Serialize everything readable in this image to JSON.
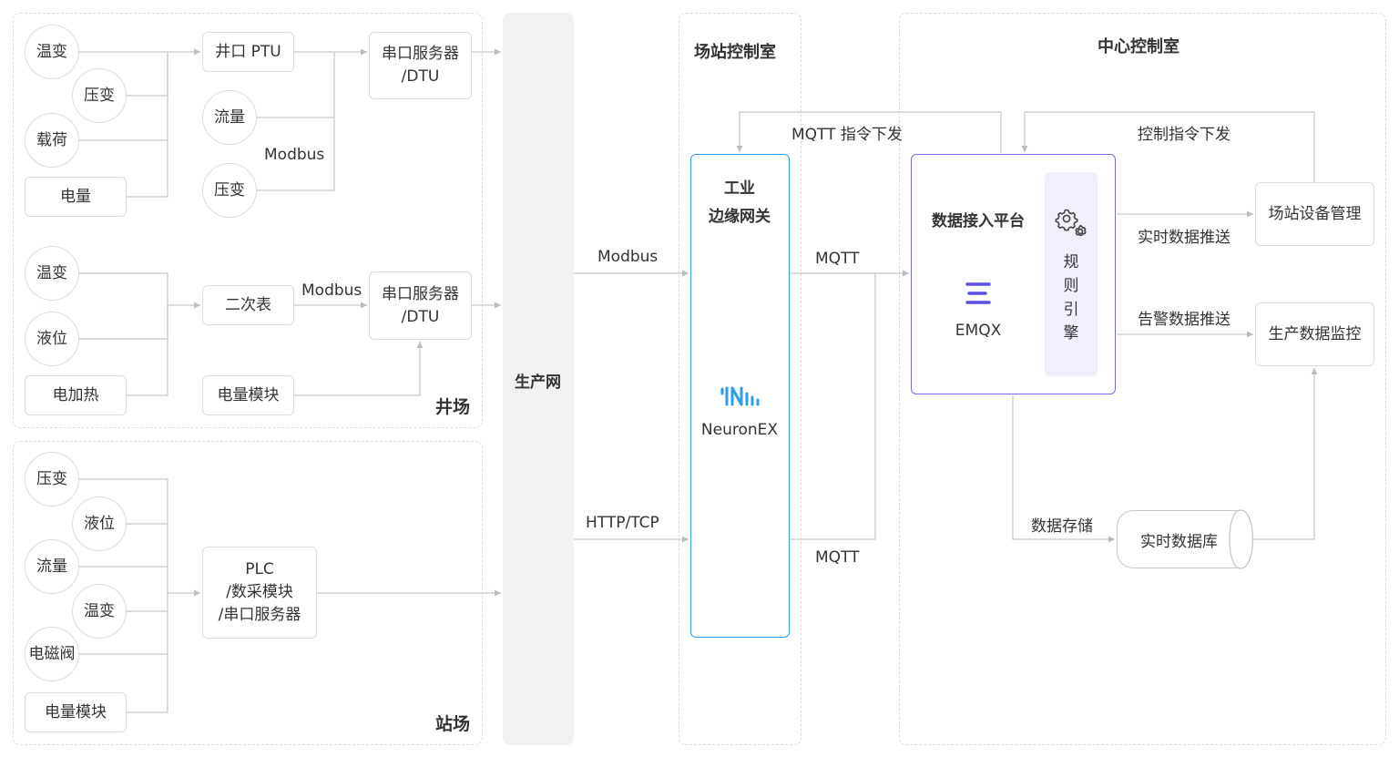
{
  "colors": {
    "line": "#c8c8c8",
    "node_border": "#dddddd",
    "gateway": "#2e9ee8",
    "platform": "#7a68e0",
    "rule_bg": "#f1effc",
    "emqx": "#5b4fe0",
    "neuron": "#2e9ee8",
    "band": "#f2f2f2"
  },
  "icons": [
    "emqx-logo-icon",
    "neuronex-logo-icon",
    "gear-icon"
  ],
  "well": {
    "title": "井场",
    "r1": {
      "wentemp": "温变",
      "yabian": "压变",
      "zaihe": "载荷",
      "dianliang": "电量",
      "ptu": "井口 PTU",
      "liuliang": "流量",
      "yabian2": "压变",
      "modbus": "Modbus",
      "serial": "串口服务器\n/DTU"
    },
    "r2": {
      "wentemp": "温变",
      "yewei": "液位",
      "jiare": "电加热",
      "meter": "二次表",
      "modbus": "Modbus",
      "serial": "串口服务器\n/DTU",
      "module": "电量模块"
    }
  },
  "station": {
    "title": "站场",
    "yabian": "压变",
    "yewei": "液位",
    "liuliang": "流量",
    "wentemp": "温变",
    "valve": "电磁阀",
    "module": "电量模块",
    "plc": "PLC\n/数采模块\n/串口服务器"
  },
  "network": {
    "label": "生产网"
  },
  "edge_links": {
    "modbus": "Modbus",
    "http": "HTTP/TCP"
  },
  "site_room": {
    "title": "场站控制室",
    "gateway": {
      "title": "工业\n边缘网关",
      "product": "NeuronEX"
    },
    "mqtt_down": "MQTT 指令下发",
    "mqtt1": "MQTT",
    "mqtt2": "MQTT"
  },
  "center_room": {
    "title": "中心控制室",
    "platform": {
      "title": "数据接入平台",
      "product": "EMQX",
      "rule_engine": [
        "规",
        "则",
        "引",
        "擎"
      ]
    },
    "ctrl_down": "控制指令下发",
    "realtime_push": "实时数据推送",
    "alarm_push": "告警数据推送",
    "device_mgmt": "场站设备管理",
    "prod_monitor": "生产数据监控",
    "storage": "数据存储",
    "rtdb": "实时数据库"
  }
}
